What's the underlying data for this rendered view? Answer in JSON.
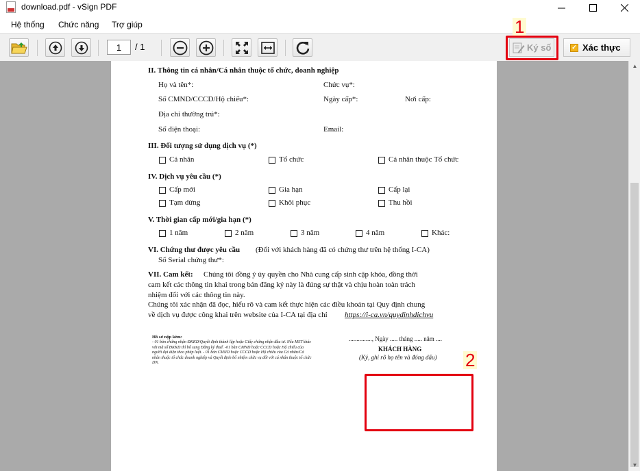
{
  "window": {
    "title": "download.pdf - vSign PDF"
  },
  "menu": [
    "Hệ thống",
    "Chức năng",
    "Trợ giúp"
  ],
  "toolbar": {
    "page_current": "1",
    "page_total": "/ 1",
    "sign_label": "Ký số",
    "verify_label": "Xác thực"
  },
  "callouts": {
    "one": "1",
    "two": "2"
  },
  "doc": {
    "s2": {
      "heading": "II. Thông tin cá nhân/Cá nhân thuộc tổ chức, doanh nghiệp",
      "name": "Họ và tên*:",
      "position": "Chức vụ*:",
      "id": "Số CMND/CCCD/Hộ chiếu*:",
      "issue_date": "Ngày cấp*:",
      "issue_place": "Nơi cấp:",
      "address": "Địa chỉ thường trú*:",
      "phone": "Số điện thoại:",
      "email": "Email:"
    },
    "s3": {
      "heading": "III. Đối tượng sử dụng dịch vụ (*)",
      "options": [
        "Cá nhân",
        "Tổ chức",
        "Cá nhân thuộc Tổ chức"
      ]
    },
    "s4": {
      "heading": "IV. Dịch vụ yêu cầu (*)",
      "options": [
        "Cấp mới",
        "Gia hạn",
        "Cấp lại",
        "Tạm dừng",
        "Khôi phục",
        "Thu hồi"
      ]
    },
    "s5": {
      "heading": "V. Thời gian cấp mới/gia hạn (*)",
      "options": [
        "1 năm",
        "2 năm",
        "3 năm",
        "4 năm",
        "Khác:"
      ]
    },
    "s6": {
      "heading": "VI. Chứng thư được yêu cầu",
      "note": "(Đối với khách hàng đã có chứng thư trên hệ thống I-CA)",
      "serial": "Số Serial chứng thư*:"
    },
    "s7": {
      "heading": "VII. Cam kết:",
      "line1": "Chúng tôi đồng ý ủy quyền cho Nhà cung cấp sinh cặp khóa, đồng thời",
      "line2": "cam kết các thông tin khai trong bản đăng ký này là đúng sự thật và chịu hoàn toàn trách",
      "line3": "nhiệm đối với các thông tin này.",
      "line4": "Chúng tôi xác nhận đã đọc, hiểu rõ và cam kết thực hiện các điều khoản tại Quy định chung",
      "line5": "về dịch vụ được công khai trên website của I-CA tại địa chỉ",
      "link": "https://i-ca.vn/quydinhdichvu"
    },
    "attach": {
      "heading": "Hồ sơ nộp kèm:",
      "text": "- 01 bản chứng nhận ĐKKD/Quyết định thành lập hoặc Giấy chứng nhận đầu tư. Nếu MST khác với mã số ĐKKD thì bổ sung Đăng ký thuế. -01 bản CMND hoặc CCCD hoặc Hộ chiếu của người đại diện theo pháp luật. - 01 bản CMND hoặc CCCD hoặc Hộ chiếu của Cá nhân/Cá nhân thuộc tổ chức doanh nghiệp và Quyết định bổ nhiệm chức vụ đối với cá nhân thuộc tổ chức DN."
    },
    "signature": {
      "date_line": "..............., Ngày ..... tháng ..... năm ....",
      "title": "KHÁCH HÀNG",
      "note": "(Ký, ghi rõ họ tên và đóng dấu)"
    }
  }
}
